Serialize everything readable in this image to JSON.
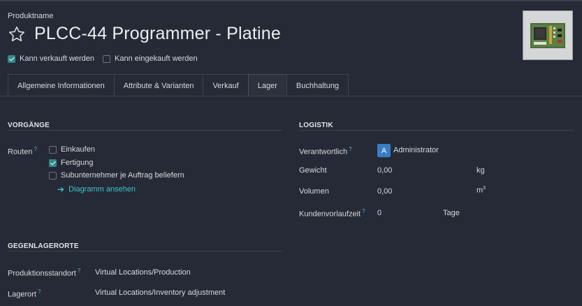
{
  "header": {
    "name_label": "Produktname",
    "title": "PLCC-44 Programmer - Platine",
    "image_icon": "circuit-board-image"
  },
  "flags": [
    {
      "label": "Kann verkauft werden",
      "checked": true
    },
    {
      "label": "Kann eingekauft werden",
      "checked": false
    }
  ],
  "tabs": [
    {
      "label": "Allgemeine Informationen",
      "active": false
    },
    {
      "label": "Attribute & Varianten",
      "active": false
    },
    {
      "label": "Verkauf",
      "active": false
    },
    {
      "label": "Lager",
      "active": true
    },
    {
      "label": "Buchhaltung",
      "active": false
    }
  ],
  "operations": {
    "heading": "VORGÄNGE",
    "routes_label": "Routen",
    "help_mark": "?",
    "routes": [
      {
        "label": "Einkaufen",
        "checked": false
      },
      {
        "label": "Fertigung",
        "checked": true
      },
      {
        "label": "Subunternehmer je Auftrag beliefern",
        "checked": false
      }
    ],
    "diagram_link": "Diagramm ansehen"
  },
  "logistics": {
    "heading": "LOGISTIK",
    "responsible_label": "Verantwortlich",
    "responsible_avatar": "A",
    "responsible_value": "Administrator",
    "weight_label": "Gewicht",
    "weight_value": "0,00",
    "weight_unit": "kg",
    "volume_label": "Volumen",
    "volume_value": "0,00",
    "volume_unit": "m",
    "volume_unit_exp": "3",
    "lead_label": "Kundenvorlaufzeit",
    "lead_value": "0",
    "lead_unit": "Tage"
  },
  "counterpart": {
    "heading": "GEGENLAGERORTE",
    "production_label": "Produktionsstandort",
    "production_value": "Virtual Locations/Production",
    "inventory_label": "Lagerort",
    "inventory_value": "Virtual Locations/Inventory adjustment"
  },
  "colors": {
    "background": "#262a36",
    "accent": "#2f8a8e",
    "link": "#3fc3c8",
    "avatar": "#3b7dc4"
  }
}
